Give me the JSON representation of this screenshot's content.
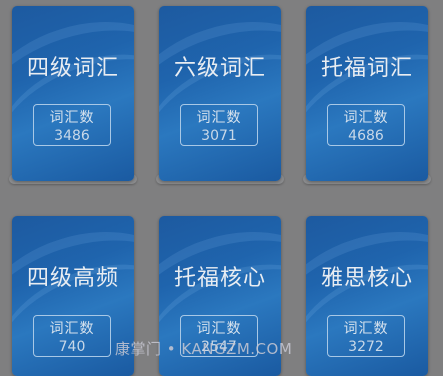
{
  "cards": [
    {
      "title": "四级词汇",
      "label": "词汇数",
      "count": "3486"
    },
    {
      "title": "六级词汇",
      "label": "词汇数",
      "count": "3071"
    },
    {
      "title": "托福词汇",
      "label": "词汇数",
      "count": "4686"
    },
    {
      "title": "四级高频",
      "label": "词汇数",
      "count": "740"
    },
    {
      "title": "托福核心",
      "label": "词汇数",
      "count": "2547"
    },
    {
      "title": "雅思核心",
      "label": "词汇数",
      "count": "3272"
    }
  ],
  "watermark": "康掌门 • KANGZM.COM",
  "colors": {
    "background": "#7f7f80",
    "card": "#1f64ad",
    "badge_border": "#a8c8e6"
  }
}
